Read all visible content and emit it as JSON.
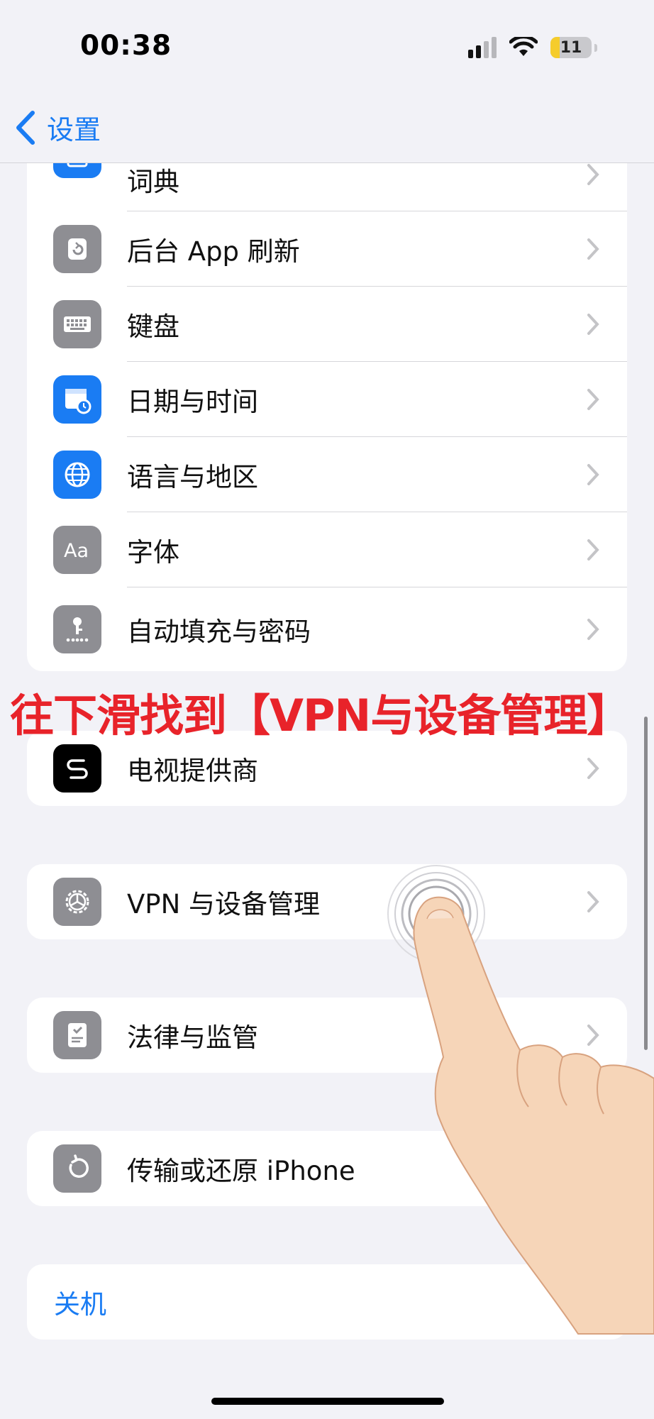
{
  "status_bar": {
    "time": "00:38",
    "battery": "11",
    "battery_color": "#f5cc2c",
    "icons": [
      "cellular-signal-icon",
      "wifi-icon",
      "battery-icon"
    ]
  },
  "nav": {
    "back_label": "设置",
    "accent_color": "#1a7cf3"
  },
  "group1": {
    "items": [
      {
        "label": "词典",
        "icon": "dictionary-icon"
      },
      {
        "label": "后台 App 刷新",
        "icon": "background-refresh-icon"
      },
      {
        "label": "键盘",
        "icon": "keyboard-icon"
      },
      {
        "label": "日期与时间",
        "icon": "calendar-clock-icon"
      },
      {
        "label": "语言与地区",
        "icon": "globe-icon"
      },
      {
        "label": "字体",
        "icon": "font-icon"
      },
      {
        "label": "自动填充与密码",
        "icon": "key-icon"
      }
    ]
  },
  "annotation": {
    "instruction": "往下滑找到【VPN与设备管理】",
    "color": "#e8232a"
  },
  "group2": {
    "label": "电视提供商",
    "icon": "tv-provider-icon"
  },
  "group3": {
    "label": "VPN 与设备管理",
    "icon": "gear-icon"
  },
  "group4": {
    "label": "法律与监管",
    "icon": "legal-icon"
  },
  "group5": {
    "label": "传输或还原 iPhone",
    "icon": "reset-icon"
  },
  "group6": {
    "label": "关机"
  }
}
